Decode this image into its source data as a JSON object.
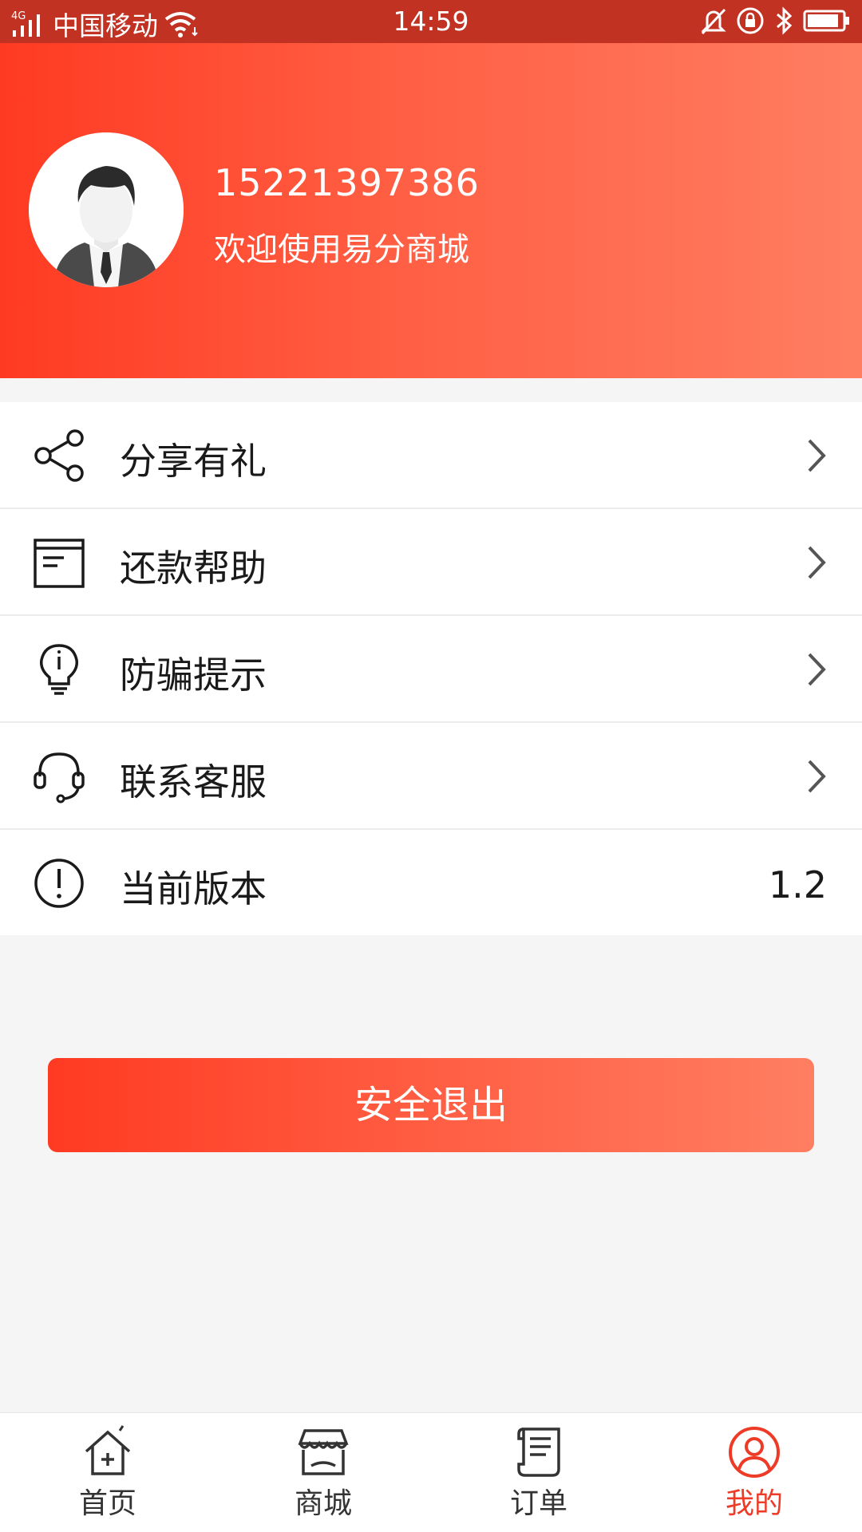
{
  "status_bar": {
    "network": "4G",
    "carrier": "中国移动",
    "time": "14:59"
  },
  "profile": {
    "phone": "15221397386",
    "welcome": "欢迎使用易分商城"
  },
  "menu": {
    "items": [
      {
        "label": "分享有礼",
        "icon": "share-icon"
      },
      {
        "label": "还款帮助",
        "icon": "document-icon"
      },
      {
        "label": "防骗提示",
        "icon": "lightbulb-icon"
      },
      {
        "label": "联系客服",
        "icon": "headset-icon"
      },
      {
        "label": "当前版本",
        "icon": "alert-circle-icon",
        "value": "1.2"
      }
    ]
  },
  "logout": {
    "label": "安全退出"
  },
  "bottom_nav": {
    "items": [
      {
        "label": "首页",
        "icon": "home-icon"
      },
      {
        "label": "商城",
        "icon": "store-icon"
      },
      {
        "label": "订单",
        "icon": "order-icon"
      },
      {
        "label": "我的",
        "icon": "user-icon",
        "active": true
      }
    ]
  },
  "colors": {
    "status_bar": "#c13223",
    "brand_start": "#ff3a22",
    "brand_end": "#ff7e62",
    "active_tab": "#ee3b27"
  }
}
